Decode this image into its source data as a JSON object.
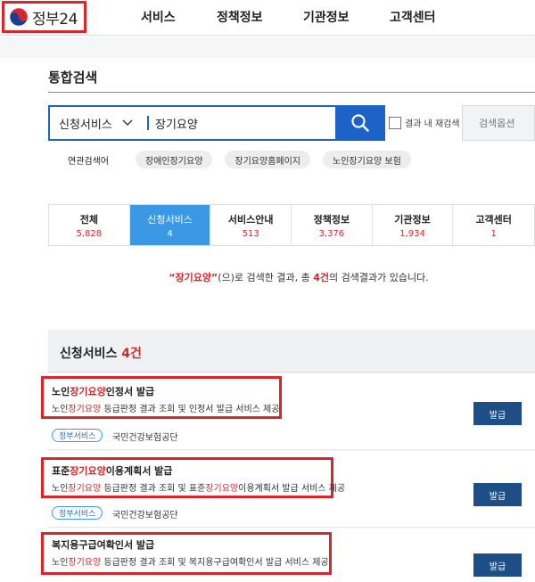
{
  "header": {
    "logo_text": "정부24",
    "nav": [
      "서비스",
      "정책정보",
      "기관정보",
      "고객센터"
    ]
  },
  "search": {
    "section_title": "통합검색",
    "category": "신청서비스",
    "query": "장기요양",
    "recheck_label": "결과 내 재검색",
    "options_label": "검색옵션",
    "related_label": "연관검색어",
    "related_terms": [
      "장애인장기요양",
      "장기요양홈페이지",
      "노인장기요양 보험"
    ]
  },
  "tabs": [
    {
      "label": "전체",
      "count": "5,828"
    },
    {
      "label": "신청서비스",
      "count": "4"
    },
    {
      "label": "서비스안내",
      "count": "513"
    },
    {
      "label": "정책정보",
      "count": "3,376"
    },
    {
      "label": "기관정보",
      "count": "1,934"
    },
    {
      "label": "고객센터",
      "count": "1"
    }
  ],
  "summary": {
    "quote_open": "“",
    "keyword": "장기요양",
    "quote_close": "”",
    "middle": "(으)로 검색한 결과, 총 ",
    "count": "4건",
    "end": "의 검색결과가 있습니다."
  },
  "list": {
    "title": "신청서비스",
    "count": "4건",
    "items": [
      {
        "title_pre": "노인",
        "title_hl": "장기요양",
        "title_post": "인정서 발급",
        "desc_pre": "노인",
        "desc_hl": "장기요양",
        "desc_post": " 등급판정 결과 조회 및 인정서 발급 서비스 제공",
        "tag": "정부서비스",
        "org": "국민건강보험공단",
        "button": "발급"
      },
      {
        "title_pre": "표준",
        "title_hl": "장기요양",
        "title_post": "이용계획서 발급",
        "desc_pre": "노인",
        "desc_hl": "장기요양",
        "desc_mid": " 등급판정 결과 조회 및 표준",
        "desc_hl2": "장기요양",
        "desc_post": "이용계획서 발급 서비스 제공",
        "tag": "정부서비스",
        "org": "국민건강보험공단",
        "button": "발급"
      },
      {
        "title": "복지용구급여확인서 발급",
        "desc_pre": "노인",
        "desc_hl": "장기요양",
        "desc_post": " 등급판정 결과 조회 및 복지용구급여확인서 발급 서비스 제공",
        "button": "발급"
      }
    ]
  },
  "colors": {
    "primary_blue": "#1c62c7",
    "active_tab": "#3b98e5",
    "highlight_red": "#d9262c",
    "issue_button": "#1e4e86"
  }
}
